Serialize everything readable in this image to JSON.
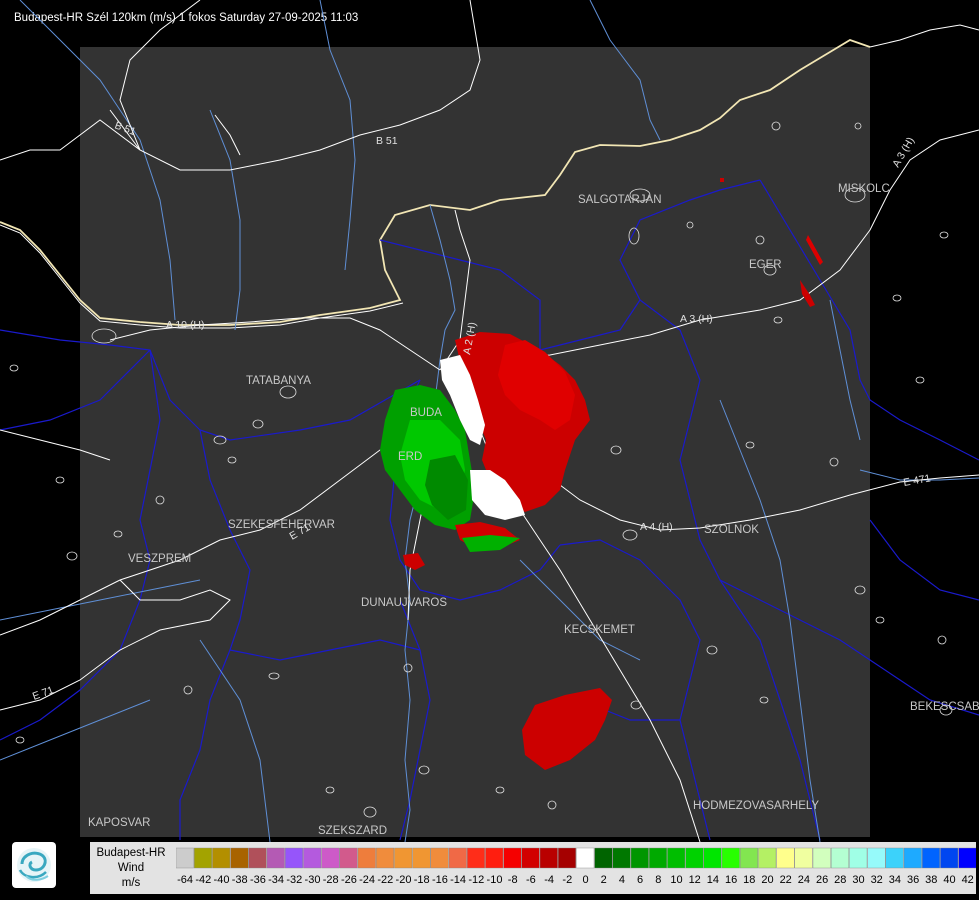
{
  "title": "Budapest-HR Szél 120km (m/s) 1 fokos Saturday 27-09-2025 11:03",
  "cities": [
    "SALGOTARJAN",
    "MISKOLC",
    "EGER",
    "TATABANYA",
    "BUDA",
    "ERD",
    "SZEKESFEHERVAR",
    "VESZPREM",
    "DUNAUJVAROS",
    "SZOLNOK",
    "KECSKEMET",
    "HODMEZOVASARHELY",
    "BEKESCSABA",
    "KAPOSVAR",
    "SZEKSZARD"
  ],
  "roads": [
    "B 51",
    "B 51",
    "A 3 (H)",
    "A 3 (H)",
    "A 10 (H)",
    "A 2 (H)",
    "A 4 (H)",
    "E 71",
    "E 71",
    "E 471"
  ],
  "legend": {
    "title_lines": [
      "Budapest-HR",
      "Wind",
      "m/s"
    ],
    "ticks": [
      "-64",
      "-42",
      "-40",
      "-38",
      "-36",
      "-34",
      "-32",
      "-30",
      "-28",
      "-26",
      "-24",
      "-22",
      "-20",
      "-18",
      "-16",
      "-14",
      "-12",
      "-10",
      "-8",
      "-6",
      "-4",
      "-2",
      "0",
      "2",
      "4",
      "6",
      "8",
      "10",
      "12",
      "14",
      "16",
      "18",
      "20",
      "22",
      "24",
      "26",
      "28",
      "30",
      "32",
      "34",
      "36",
      "38",
      "40",
      "42"
    ],
    "colors": [
      "#cccccc",
      "#a3a300",
      "#b38f00",
      "#a86300",
      "#b0505a",
      "#b45ab4",
      "#9655fa",
      "#b45ade",
      "#cd5ac8",
      "#d25a8c",
      "#ee7d3c",
      "#f08c3c",
      "#f09632",
      "#f09632",
      "#f08c3c",
      "#f06946",
      "#ff2d19",
      "#ff1e0f",
      "#f50000",
      "#d20000",
      "#b90000",
      "#a50000",
      "#ffffff",
      "#006400",
      "#007800",
      "#009600",
      "#00aa00",
      "#00be00",
      "#00d200",
      "#00e600",
      "#28ff00",
      "#82e650",
      "#b4f064",
      "#ffff8c",
      "#f0ffa0",
      "#d2ffbe",
      "#b4ffd2",
      "#a0ffe6",
      "#96fafa",
      "#3cd2fa",
      "#1eaaff",
      "#0064ff",
      "#0046f0",
      "#0000ff"
    ]
  },
  "logo_icon": "weather-service-swirl-icon"
}
